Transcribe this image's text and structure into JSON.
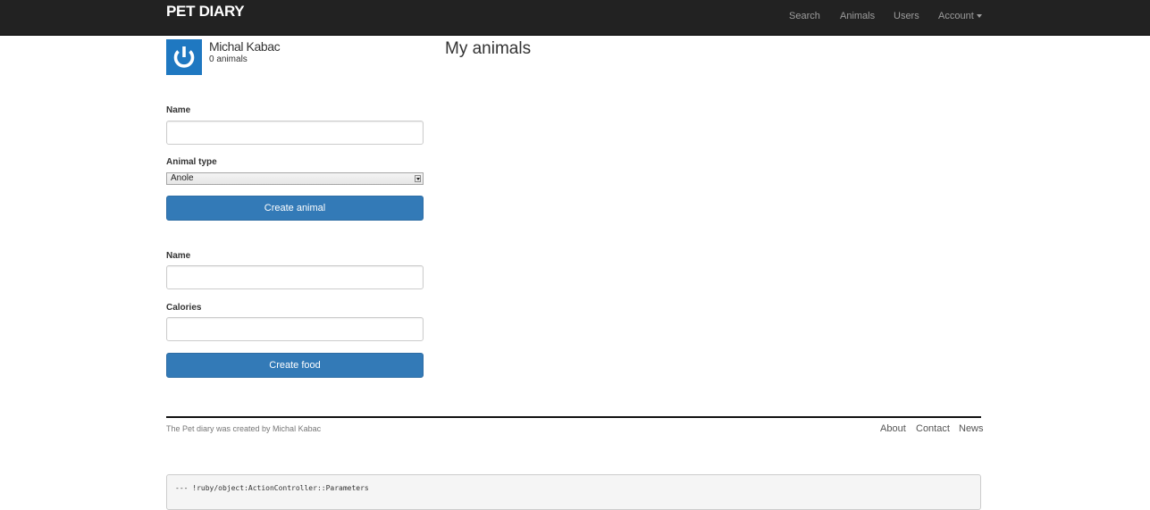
{
  "navbar": {
    "brand": "PET DIARY",
    "links": [
      "Search",
      "Animals",
      "Users",
      "Account"
    ]
  },
  "profile": {
    "name": "Michal Kabac",
    "animal_count": "0 animals",
    "avatar_icon": "power-icon"
  },
  "main": {
    "title": "My animals"
  },
  "animal_form": {
    "name_label": "Name",
    "name_value": "",
    "type_label": "Animal type",
    "type_selected": "Anole",
    "submit_label": "Create animal"
  },
  "food_form": {
    "name_label": "Name",
    "name_value": "",
    "calories_label": "Calories",
    "calories_value": "",
    "submit_label": "Create food"
  },
  "footer": {
    "credit": "The Pet diary was created by Michal Kabac",
    "links": [
      "About",
      "Contact",
      "News"
    ]
  },
  "debug": {
    "text": "--- !ruby/object:ActionController::Parameters"
  },
  "colors": {
    "navbar": "#222222",
    "primary_button": "#337ab7",
    "avatar": "#1f78c1"
  }
}
